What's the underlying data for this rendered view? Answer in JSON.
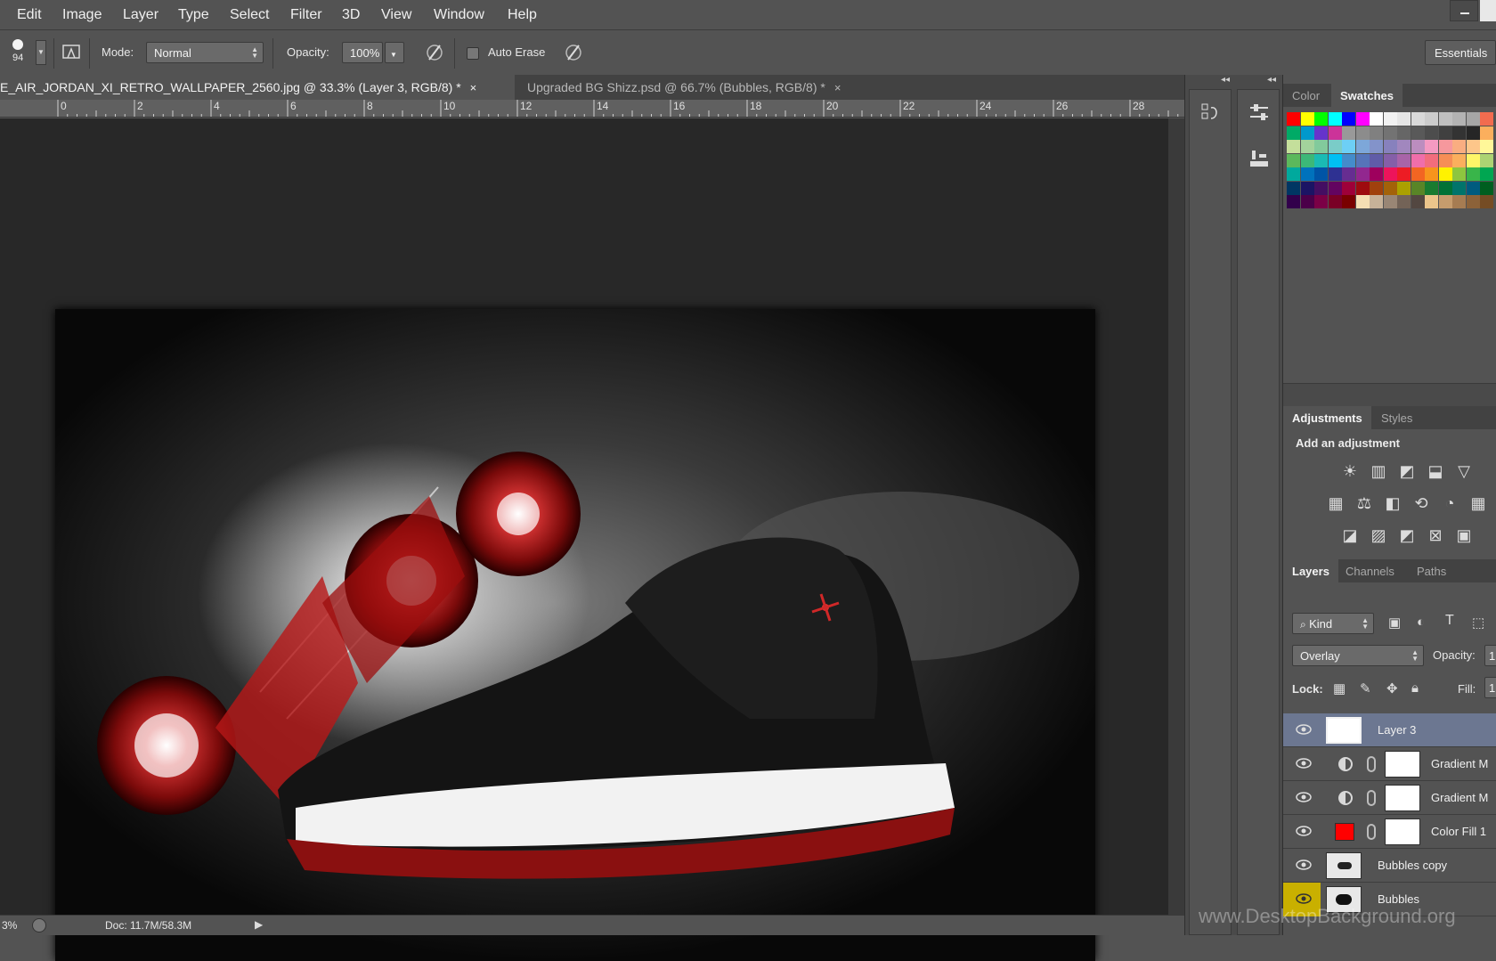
{
  "menu": [
    "Edit",
    "Image",
    "Layer",
    "Type",
    "Select",
    "Filter",
    "3D",
    "View",
    "Window",
    "Help"
  ],
  "options": {
    "brush_size": "94",
    "mode_label": "Mode:",
    "mode_value": "Normal",
    "opacity_label": "Opacity:",
    "opacity_value": "100%",
    "auto_erase_label": "Auto Erase",
    "workspace": "Essentials"
  },
  "tabs": [
    {
      "label": "E_AIR_JORDAN_XI_RETRO_WALLPAPER_2560.jpg @ 33.3% (Layer 3, RGB/8) *",
      "close": "×"
    },
    {
      "label": "Upgraded BG Shizz.psd @ 66.7% (Bubbles, RGB/8) *",
      "close": "×"
    }
  ],
  "ruler": [
    "0",
    "2",
    "4",
    "6",
    "8",
    "10",
    "12",
    "14",
    "16",
    "18",
    "20",
    "22",
    "24",
    "26",
    "28"
  ],
  "status": {
    "zoom": "3%",
    "doc": "Doc: 11.7M/58.3M"
  },
  "color_panel": {
    "tabs": [
      "Color",
      "Swatches"
    ]
  },
  "swatches": [
    [
      "#ff0000",
      "#ffff00",
      "#00ff00",
      "#00ffff",
      "#0000ff",
      "#ff00ff",
      "#ffffff",
      "#f2f2f2",
      "#e6e6e6",
      "#d9d9d9",
      "#cccccc",
      "#bfbfbf",
      "#b3b3b3",
      "#a6a6a6",
      "#f26c4f"
    ],
    [
      "#00aa66",
      "#0099cc",
      "#6633cc",
      "#cc3399",
      "#999999",
      "#8c8c8c",
      "#808080",
      "#737373",
      "#666666",
      "#595959",
      "#4d4d4d",
      "#404040",
      "#333333",
      "#262626",
      "#fbaf5d"
    ],
    [
      "#c4df9b",
      "#a3d39c",
      "#82ca9c",
      "#7accc8",
      "#6dcff6",
      "#7da7d9",
      "#8393ca",
      "#8781bd",
      "#a187be",
      "#bc8dbf",
      "#f49ac2",
      "#f6989d",
      "#f9ad81",
      "#fdc68a",
      "#fff799"
    ],
    [
      "#5cb85c",
      "#3cb878",
      "#1abbb4",
      "#00bff3",
      "#448ccb",
      "#5674b9",
      "#605ca8",
      "#855fa8",
      "#a864a8",
      "#f06eaa",
      "#f26d7d",
      "#f68e56",
      "#fbaf5d",
      "#fff568",
      "#acd373"
    ],
    [
      "#00a99d",
      "#0072bc",
      "#0054a6",
      "#2e3192",
      "#662d91",
      "#92278f",
      "#9e005d",
      "#ed145b",
      "#ed1c24",
      "#f26522",
      "#f7941d",
      "#fff200",
      "#8dc63f",
      "#39b54a",
      "#00a651"
    ],
    [
      "#003663",
      "#1b1464",
      "#440e62",
      "#630460",
      "#9e0039",
      "#9e0b0f",
      "#a0410d",
      "#a36209",
      "#aba000",
      "#598527",
      "#197b30",
      "#007236",
      "#00746b",
      "#005b7f",
      "#005e20"
    ],
    [
      "#32004b",
      "#4b0049",
      "#7b0046",
      "#7a0026",
      "#790000",
      "#f5deb3",
      "#c7b299",
      "#998675",
      "#736357",
      "#534741",
      "#ecc58b",
      "#c69c6d",
      "#a67c52",
      "#8c6239",
      "#754c24"
    ]
  ],
  "adjustments": {
    "tabs": [
      "Adjustments",
      "Styles"
    ],
    "hint": "Add an adjustment",
    "icons_row1": [
      "☀",
      "▥",
      "◩",
      "⬓",
      "▽"
    ],
    "icons_row2": [
      "▦",
      "⚖",
      "◧",
      "⟲",
      "◔",
      "▦"
    ],
    "icons_row3": [
      "◪",
      "▨",
      "◩",
      "⊠",
      "▣"
    ]
  },
  "layers_panel": {
    "tabs": [
      "Layers",
      "Channels",
      "Paths"
    ],
    "kind": "Kind",
    "blend_mode": "Overlay",
    "opacity_label": "Opacity:",
    "opacity_value": "1",
    "lock_label": "Lock:",
    "fill_label": "Fill:",
    "fill_value": "1"
  },
  "layers": [
    {
      "name": "Layer 3"
    },
    {
      "name": "Gradient M"
    },
    {
      "name": "Gradient M"
    },
    {
      "name": "Color Fill 1"
    },
    {
      "name": "Bubbles copy"
    },
    {
      "name": "Bubbles"
    }
  ],
  "watermark": "www.DesktopBackground.org",
  "colors": {
    "accent_selected": "#6c7791",
    "fill_swatch": "#ff0000",
    "eye_highlight": "#c9b000"
  }
}
